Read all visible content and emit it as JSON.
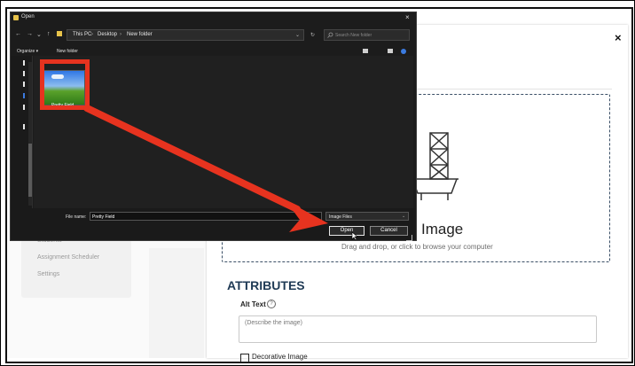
{
  "background_page": {
    "sidebar": {
      "item_partial": "Students",
      "items": [
        "Assignment Scheduler",
        "Settings"
      ]
    },
    "modal": {
      "close_label": "×",
      "dropzone": {
        "title": "Image",
        "subtitle": "Drag and drop, or click to browse your computer"
      },
      "attributes_heading": "ATTRIBUTES",
      "alt_text_label": "Alt Text",
      "help_icon": "?",
      "alt_text_placeholder": "(Describe the image)",
      "decorative_label": "Decorative Image"
    }
  },
  "dialog": {
    "title": "Open",
    "close_label": "×",
    "nav": {
      "back": "←",
      "forward": "→",
      "up": "↑",
      "recent": "⌄"
    },
    "breadcrumb": [
      "This PC",
      "Desktop",
      "New folder"
    ],
    "breadcrumb_separator": "›",
    "address_dropdown": "⌄",
    "refresh": "↻",
    "search_placeholder": "Search New folder",
    "toolbar": {
      "organize": "Organize ▾",
      "new_folder": "New folder"
    },
    "files": [
      {
        "name": "Pretty Field"
      }
    ],
    "file_name_label": "File name:",
    "file_name_value": "Pretty Field",
    "file_type_filter": "Image Files",
    "open_button": "Open",
    "cancel_button": "Cancel"
  },
  "annotation": {
    "highlight_color": "#e7331f",
    "arrow_color": "#e7331f"
  },
  "icons": {
    "dialog_title_icon": "folder-icon",
    "view_icon": "view-options-icon",
    "preview_pane_icon": "preview-pane-icon",
    "help_icon": "help-icon"
  }
}
